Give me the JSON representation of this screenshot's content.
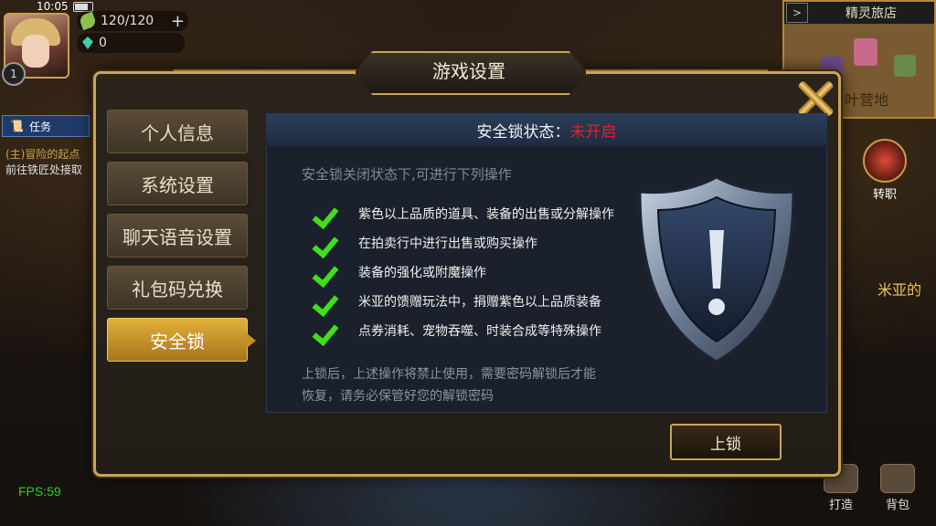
{
  "status_bar": {
    "time": "10:05"
  },
  "hud": {
    "level": "1",
    "energy": "120/120",
    "gems": "0",
    "task_tab": "任务",
    "task_line1": "(主)冒险的起点",
    "task_line2": "前往铁匠处接取",
    "fps": "FPS:59"
  },
  "minimap": {
    "title": "精灵旅店",
    "area": "叶营地"
  },
  "side": {
    "job_change": "转职",
    "npc_label": "米亚的"
  },
  "bottom": {
    "forge": "打造",
    "bag": "背包"
  },
  "dialog": {
    "title": "游戏设置",
    "menu": [
      {
        "label": "个人信息"
      },
      {
        "label": "系统设置"
      },
      {
        "label": "聊天语音设置"
      },
      {
        "label": "礼包码兑换"
      },
      {
        "label": "安全锁",
        "active": true
      }
    ],
    "lock_status_label": "安全锁状态：",
    "lock_status_value": "未开启",
    "intro": "安全锁关闭状态下,可进行下列操作",
    "operations": [
      "紫色以上品质的道具、装备的出售或分解操作",
      "在拍卖行中进行出售或购买操作",
      "装备的强化或附魔操作",
      "米亚的馈赠玩法中，捐赠紫色以上品质装备",
      "点券消耗、宠物吞噬、时装合成等特殊操作"
    ],
    "note_line1": "上锁后，上述操作将禁止使用，需要密码解锁后才能",
    "note_line2": "恢复，请务必保管好您的解锁密码",
    "lock_button": "上锁"
  },
  "colors": {
    "gold_border": "#c9a459",
    "active_tab": "#d29a28",
    "status_off": "#e02424",
    "check_green": "#3fe01a",
    "panel_blue": "#1a212c"
  },
  "icons": {
    "close": "close-icon",
    "check": "check-icon",
    "shield": "shield-warning-icon"
  }
}
